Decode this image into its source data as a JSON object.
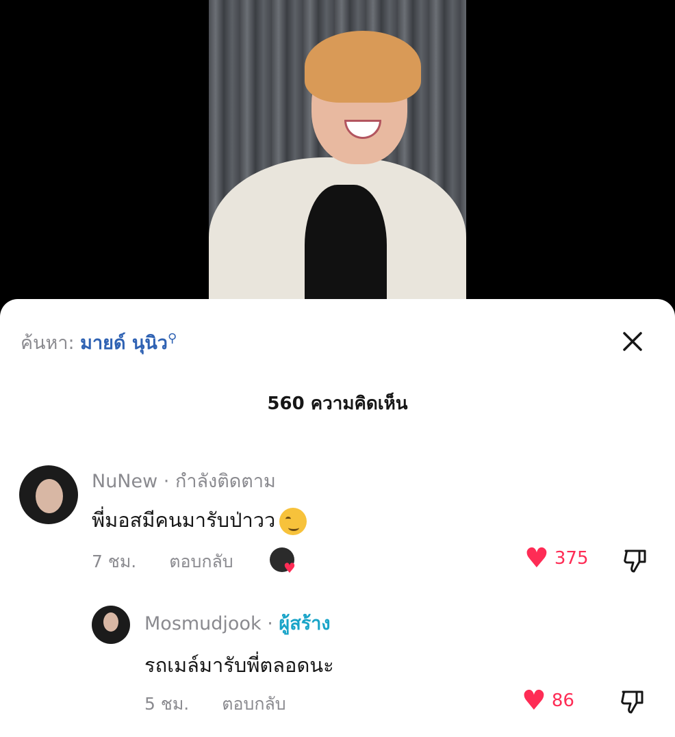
{
  "search": {
    "prefix": "ค้นหา:",
    "term": "มายด์ นุนิว"
  },
  "comments_count": "560 ความคิดเห็น",
  "comments": [
    {
      "username": "NuNew",
      "separator": "·",
      "tag": "กำลังติดตาม",
      "text": "พี่มอสมีคนมารับป่าวว",
      "emoji": "smirk-emoji",
      "time": "7 ชม.",
      "reply_label": "ตอบกลับ",
      "likes": "375"
    },
    {
      "username": "Mosmudjook",
      "separator": "·",
      "tag": "ผู้สร้าง",
      "text": "รถเมล์มารับพี่ตลอดนะ",
      "time": "5 ชม.",
      "reply_label": "ตอบกลับ",
      "likes": "86"
    }
  ],
  "colors": {
    "accent_like": "#fe2c55",
    "search_term": "#2f62b3",
    "creator_tag": "#19a4c8"
  }
}
